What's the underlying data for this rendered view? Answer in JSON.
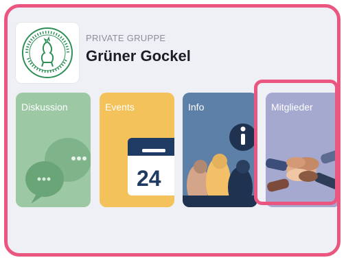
{
  "group": {
    "privacy_label": "PRIVATE GRUPPE",
    "name": "Grüner Gockel"
  },
  "logo": {
    "icon": "rooster-seal-icon",
    "arc_text_top": "nachhaltig · umweltgerecht · glaubhaft",
    "arc_text_bottom": "Kirchliches Umweltmanagement"
  },
  "tiles": [
    {
      "id": "diskussion",
      "label": "Diskussion",
      "icon": "speech-bubbles-icon",
      "color": "#9cc9a4"
    },
    {
      "id": "events",
      "label": "Events",
      "icon": "calendar-icon",
      "date_number": "24",
      "color": "#f3c25a"
    },
    {
      "id": "info",
      "label": "Info",
      "icon": "info-icon",
      "color": "#5d80a8"
    },
    {
      "id": "mitglieder",
      "label": "Mitglieder",
      "icon": "team-hands-icon",
      "color": "#a6a9cf"
    }
  ],
  "colors": {
    "highlight": "#ea5680",
    "background": "#eef0f6"
  }
}
